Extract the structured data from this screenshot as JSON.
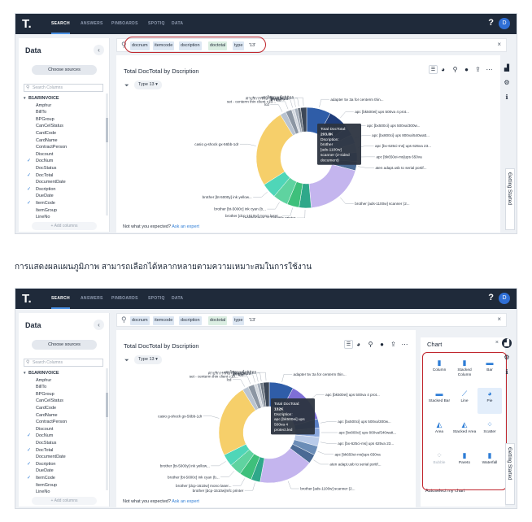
{
  "caption": "การแสดงผลแผนภูมิภาพ สามารถเลือกได้หลากหลายตามความเหมาะสมในการใช้งาน",
  "app": {
    "logo": "T.",
    "nav": [
      "SEARCH",
      "ANSWERS",
      "PINBOARDS",
      "SPOTIQ",
      "DATA"
    ],
    "help": "?",
    "avatar": "D"
  },
  "sidebar": {
    "title": "Data",
    "collapse": "‹",
    "choose_sources": "Choose sources",
    "search_placeholder": "Search Columns",
    "root": "B1ARINVOICE",
    "columns": [
      {
        "name": "Amphur",
        "checked": false
      },
      {
        "name": "BillTo",
        "checked": false
      },
      {
        "name": "BPGroup",
        "checked": false
      },
      {
        "name": "CanCelStatus",
        "checked": false
      },
      {
        "name": "CardCode",
        "checked": false
      },
      {
        "name": "CardName",
        "checked": false
      },
      {
        "name": "ContractPerson",
        "checked": false
      },
      {
        "name": "Discount",
        "checked": false
      },
      {
        "name": "DocNum",
        "checked": true
      },
      {
        "name": "DocStatus",
        "checked": false
      },
      {
        "name": "DocTotal",
        "checked": true
      },
      {
        "name": "DocumentDate",
        "checked": false
      },
      {
        "name": "Dscription",
        "checked": true
      },
      {
        "name": "DueDate",
        "checked": false
      },
      {
        "name": "ItemCode",
        "checked": true
      },
      {
        "name": "ItemGroup",
        "checked": false
      },
      {
        "name": "LineNo",
        "checked": false
      }
    ],
    "add_columns": "+ Add columns"
  },
  "search": {
    "tokens": [
      {
        "text": "docnum",
        "kind": "attr"
      },
      {
        "text": "itemcode",
        "kind": "attr"
      },
      {
        "text": "dscription",
        "kind": "attr"
      },
      {
        "text": "doctotal",
        "kind": "measure"
      },
      {
        "text": "type",
        "kind": "attr"
      },
      {
        "text": "'13'",
        "kind": "plain"
      }
    ],
    "clear": "×"
  },
  "answer": {
    "title": "Total DocTotal by Dscription",
    "filter_chip": "Type 13 ▾",
    "not_expected": "Not what you expected?",
    "ask_expert": "Ask an expert"
  },
  "getting_started": "Getting Started",
  "chart_picker": {
    "title": "Chart",
    "close": "×",
    "types": [
      {
        "name": "Column",
        "icon": "▮",
        "selected": false,
        "dim": false
      },
      {
        "name": "Stacked Column",
        "icon": "▮",
        "selected": false,
        "dim": false
      },
      {
        "name": "Bar",
        "icon": "▬",
        "selected": false,
        "dim": false
      },
      {
        "name": "Stacked Bar",
        "icon": "▬",
        "selected": false,
        "dim": false
      },
      {
        "name": "Line",
        "icon": "⟋",
        "selected": false,
        "dim": false
      },
      {
        "name": "Pie",
        "icon": "◕",
        "selected": true,
        "dim": false
      },
      {
        "name": "Area",
        "icon": "◭",
        "selected": false,
        "dim": false
      },
      {
        "name": "Stacked Area",
        "icon": "◭",
        "selected": false,
        "dim": false
      },
      {
        "name": "Scatter",
        "icon": "⁘",
        "selected": false,
        "dim": false
      },
      {
        "name": "Bubble",
        "icon": "⁘",
        "selected": false,
        "dim": true
      },
      {
        "name": "Pareto",
        "icon": "▮",
        "selected": false,
        "dim": false
      },
      {
        "name": "Waterfall",
        "icon": "▮",
        "selected": false,
        "dim": false
      }
    ],
    "autoselect": "Autoselect my chart"
  },
  "chart_data": [
    {
      "type": "pie",
      "title": "Total DocTotal by Dscription",
      "tooltip": [
        "Total DocTotal:",
        "203.8K",
        "Dscription:",
        "brother",
        "[ads-1100w]",
        "scanner (2-sided",
        "document)"
      ],
      "series": [
        {
          "name": "adapter 5v 3a for centerm thin...",
          "value": 8,
          "color": "#2f5da8"
        },
        {
          "name": "apc [bk500ei] ups 500va 4 prot...",
          "value": 7,
          "color": "#1f3d7a"
        },
        {
          "name": "apc [bx500ci] ups 500va/300w...",
          "value": 3,
          "color": "#5a7fc4"
        },
        {
          "name": "apc [bx800ci] ups 800va/540watt...",
          "value": 3,
          "color": "#8aa7dd"
        },
        {
          "name": "apc [bx-625ci-ms] ups 625va 23...",
          "value": 3,
          "color": "#b9cbe9"
        },
        {
          "name": "apc [bk650ei-ms]ups 650va",
          "value": 3,
          "color": "#6b8db7"
        },
        {
          "name": "aten adapt.usb to serial portif...",
          "value": 3,
          "color": "#4a6a95"
        },
        {
          "name": "brother [ads-1100w] scanner (2...",
          "value": 20,
          "color": "#c4b5ee"
        },
        {
          "name": "brother [dcp-1510w]mfc printer",
          "value": 4,
          "color": "#2fa88a"
        },
        {
          "name": "brother [dcp-1610w] mono laser...",
          "value": 4,
          "color": "#3ec07b"
        },
        {
          "name": "brother [bt-5000c] ink cyan (b...",
          "value": 5,
          "color": "#5fd3a0"
        },
        {
          "name": "brother [bt-5000y] ink yellow...",
          "value": 5,
          "color": "#4fd6b8"
        },
        {
          "name": "casio g-shock gx-56bb-1dr",
          "value": 26,
          "color": "#f6cf6a"
        },
        {
          "name": "lcd",
          "value": 2,
          "color": "#b9c3d0"
        },
        {
          "name": "set - centerm thin client c10...",
          "value": 2,
          "color": "#8c96a3"
        },
        {
          "name": "ค่า fee",
          "value": 1,
          "color": "#d4d9e0"
        },
        {
          "name": "ค่าขนส่ง",
          "value": 1,
          "color": "#a7b0bc"
        },
        {
          "name": "ค่าบริการรักษาข้อมูลระบบ",
          "value": 1,
          "color": "#6e7884"
        },
        {
          "name": "ค่าใช้จ่ายเพื่อนิมิตร",
          "value": 2,
          "color": "#3c4757"
        }
      ]
    },
    {
      "type": "pie",
      "title": "Total DocTotal by Dscription",
      "tooltip": [
        "Total DocTotal:",
        "132K",
        "Dscription:",
        "apc [bk500ei] ups",
        "500va 4",
        "protect.led"
      ],
      "series": [
        {
          "name": "adapter 5v 3a for centerm thin...",
          "value": 8,
          "color": "#2f5da8"
        },
        {
          "name": "apc [bk500ei] ups 500va 4 prot...",
          "value": 13,
          "color": "#7e6fd6"
        },
        {
          "name": "apc [bx500ci] ups 500va/300w...",
          "value": 3,
          "color": "#5a7fc4"
        },
        {
          "name": "apc [bx800ci] ups 800va/540watt...",
          "value": 3,
          "color": "#8aa7dd"
        },
        {
          "name": "apc [bx-625ci-ms] ups 625va 23...",
          "value": 3,
          "color": "#b9cbe9"
        },
        {
          "name": "apc [bk650ei-ms]ups 650va",
          "value": 3,
          "color": "#6b8db7"
        },
        {
          "name": "aten adapt.usb to serial portif...",
          "value": 3,
          "color": "#4a6a95"
        },
        {
          "name": "brother [ads-1100w] scanner (2...",
          "value": 18,
          "color": "#c4b5ee"
        },
        {
          "name": "brother [dcp-1510w]mfc printer",
          "value": 3,
          "color": "#2fa88a"
        },
        {
          "name": "brother [dcp-1610w] mono laser...",
          "value": 4,
          "color": "#3ec07b"
        },
        {
          "name": "brother [bt-5000c] ink cyan (b...",
          "value": 4,
          "color": "#5fd3a0"
        },
        {
          "name": "brother [bt-5000y] ink yellow...",
          "value": 4,
          "color": "#4fd6b8"
        },
        {
          "name": "casio g-shock gx-56bb-1dr",
          "value": 24,
          "color": "#f6cf6a"
        },
        {
          "name": "lcd",
          "value": 2,
          "color": "#b9c3d0"
        },
        {
          "name": "set - centerm thin client c10...",
          "value": 2,
          "color": "#8c96a3"
        },
        {
          "name": "ค่า fee",
          "value": 1,
          "color": "#d4d9e0"
        },
        {
          "name": "ค่าขนส่ง",
          "value": 1,
          "color": "#a7b0bc"
        },
        {
          "name": "ค่าบริการรักษาข้อมูลระบบ",
          "value": 1,
          "color": "#6e7884"
        },
        {
          "name": "ค่าใช้จ่ายเพื่อนิมิตร",
          "value": 2,
          "color": "#3c4757"
        }
      ]
    }
  ]
}
